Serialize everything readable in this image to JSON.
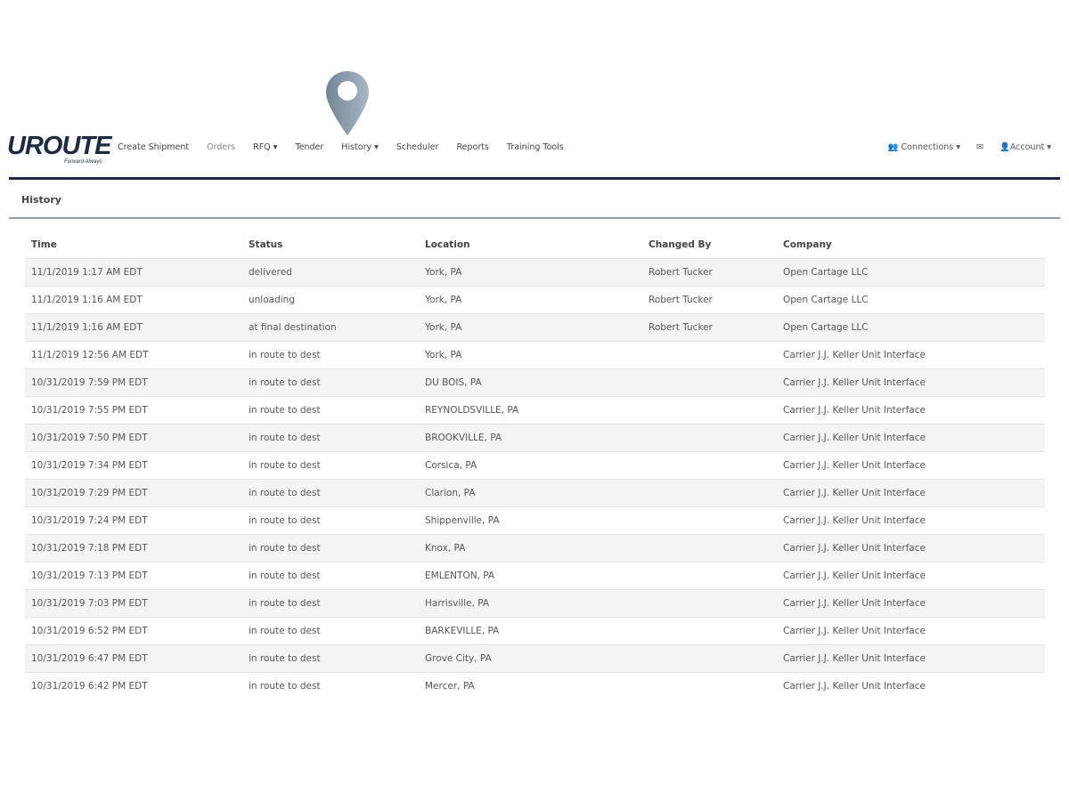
{
  "brand": {
    "name": "UROUTE",
    "tagline": "Forward Always"
  },
  "nav": {
    "items": [
      {
        "label": "Create Shipment"
      },
      {
        "label": "Orders"
      },
      {
        "label": "RFQ ▾"
      },
      {
        "label": "Tender"
      },
      {
        "label": "History ▾"
      },
      {
        "label": "Scheduler"
      },
      {
        "label": "Reports"
      },
      {
        "label": "Training Tools"
      }
    ],
    "right": {
      "connections": "Connections ▾",
      "account": "Account ▾"
    }
  },
  "panel": {
    "title": "History"
  },
  "table": {
    "headers": [
      "Time",
      "Status",
      "Location",
      "Changed By",
      "Company"
    ],
    "rows": [
      [
        "11/1/2019 1:17 AM EDT",
        "delivered",
        "York, PA",
        "Robert Tucker",
        "Open Cartage LLC"
      ],
      [
        "11/1/2019 1:16 AM EDT",
        "unloading",
        "York, PA",
        "Robert Tucker",
        "Open Cartage LLC"
      ],
      [
        "11/1/2019 1:16 AM EDT",
        "at final destination",
        "York, PA",
        "Robert Tucker",
        "Open Cartage LLC"
      ],
      [
        "11/1/2019 12:56 AM EDT",
        "in route to dest",
        "York, PA",
        "",
        "Carrier J.J. Keller Unit Interface"
      ],
      [
        "10/31/2019 7:59 PM EDT",
        "in route to dest",
        "DU BOIS, PA",
        "",
        "Carrier J.J. Keller Unit Interface"
      ],
      [
        "10/31/2019 7:55 PM EDT",
        "in route to dest",
        "REYNOLDSVILLE, PA",
        "",
        "Carrier J.J. Keller Unit Interface"
      ],
      [
        "10/31/2019 7:50 PM EDT",
        "in route to dest",
        "BROOKVILLE, PA",
        "",
        "Carrier J.J. Keller Unit Interface"
      ],
      [
        "10/31/2019 7:34 PM EDT",
        "in route to dest",
        "Corsica, PA",
        "",
        "Carrier J.J. Keller Unit Interface"
      ],
      [
        "10/31/2019 7:29 PM EDT",
        "in route to dest",
        "Clarion, PA",
        "",
        "Carrier J.J. Keller Unit Interface"
      ],
      [
        "10/31/2019 7:24 PM EDT",
        "in route to dest",
        "Shippenville, PA",
        "",
        "Carrier J.J. Keller Unit Interface"
      ],
      [
        "10/31/2019 7:18 PM EDT",
        "in route to dest",
        "Knox, PA",
        "",
        "Carrier J.J. Keller Unit Interface"
      ],
      [
        "10/31/2019 7:13 PM EDT",
        "in route to dest",
        "EMLENTON, PA",
        "",
        "Carrier J.J. Keller Unit Interface"
      ],
      [
        "10/31/2019 7:03 PM EDT",
        "in route to dest",
        "Harrisville, PA",
        "",
        "Carrier J.J. Keller Unit Interface"
      ],
      [
        "10/31/2019 6:52 PM EDT",
        "in route to dest",
        "BARKEVILLE, PA",
        "",
        "Carrier J.J. Keller Unit Interface"
      ],
      [
        "10/31/2019 6:47 PM EDT",
        "in route to dest",
        "Grove City, PA",
        "",
        "Carrier J.J. Keller Unit Interface"
      ],
      [
        "10/31/2019 6:42 PM EDT",
        "in route to dest",
        "Mercer, PA",
        "",
        "Carrier J.J. Keller Unit Interface"
      ]
    ]
  }
}
